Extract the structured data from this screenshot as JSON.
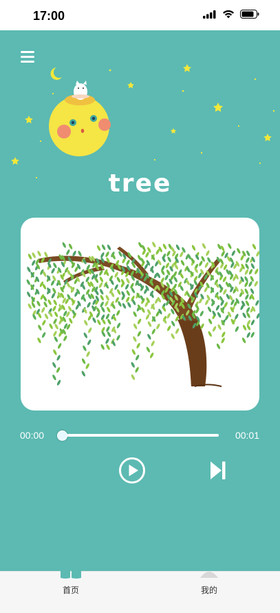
{
  "status_bar": {
    "time": "17:00",
    "icons": [
      "cellular-signal-icon",
      "wifi-icon",
      "battery-icon"
    ]
  },
  "header": {
    "menu_icon": "hamburger-menu-icon",
    "illustration": "moon-with-cat-illustration"
  },
  "word": {
    "title": "tree",
    "image": "willow-tree-illustration"
  },
  "player": {
    "current_time": "00:00",
    "total_time": "00:01",
    "progress": 0.0,
    "play_icon": "play-icon",
    "next_icon": "skip-next-icon"
  },
  "tabbar": {
    "tabs": [
      {
        "label": "首页",
        "icon": "home-tab-icon",
        "active": true
      },
      {
        "label": "我的",
        "icon": "profile-tab-icon",
        "active": false
      }
    ]
  },
  "colors": {
    "background": "#5cbab2",
    "card": "#ffffff",
    "moon": "#f5e545",
    "tabbar": "#f6f6f6"
  }
}
